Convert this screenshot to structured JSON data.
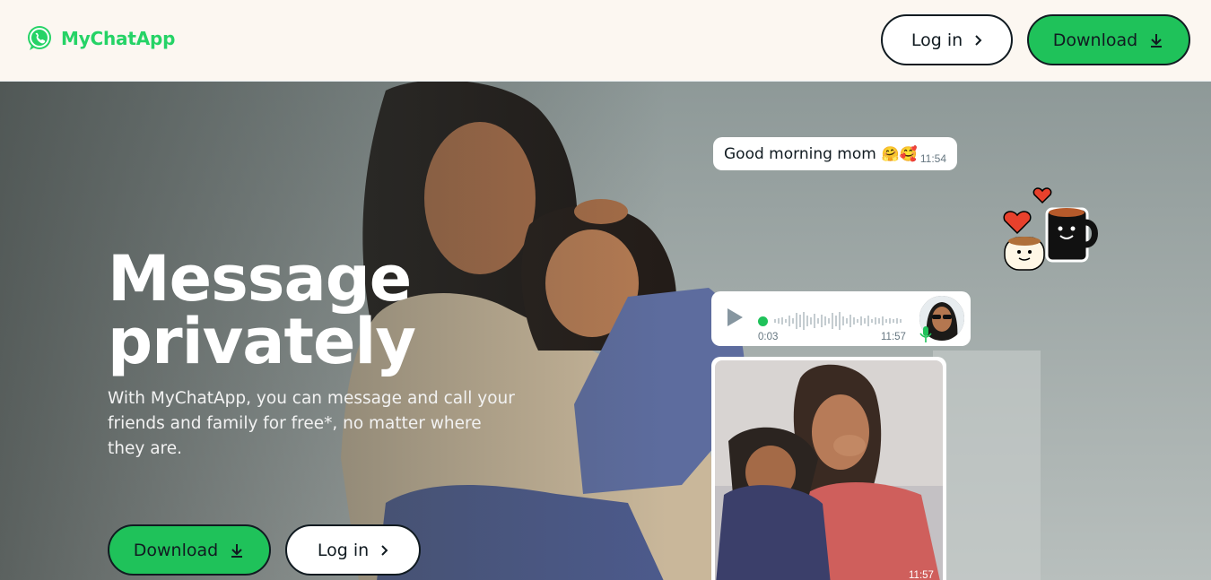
{
  "header": {
    "brand": "MyChatApp",
    "login_label": "Log in",
    "download_label": "Download"
  },
  "hero": {
    "headline_line1": "Message",
    "headline_line2": "privately",
    "subtext": "With MyChatApp, you can message and call your friends and family for free*, no matter where they are.",
    "download_label": "Download",
    "login_label": "Log in"
  },
  "chat": {
    "text_message": "Good morning mom",
    "text_emoji": "🤗🥰",
    "text_time": "11:54",
    "voice_elapsed": "0:03",
    "voice_time": "11:57",
    "photo_time": "11:57"
  },
  "colors": {
    "brand_green": "#25d366",
    "button_green": "#1fc25a",
    "header_bg": "#fcf7f1",
    "text_dark": "#111b21"
  },
  "icons": [
    "whatsapp-logo-icon",
    "chevron-right-icon",
    "download-icon",
    "play-icon",
    "mic-icon",
    "coffee-sticker-icon"
  ]
}
